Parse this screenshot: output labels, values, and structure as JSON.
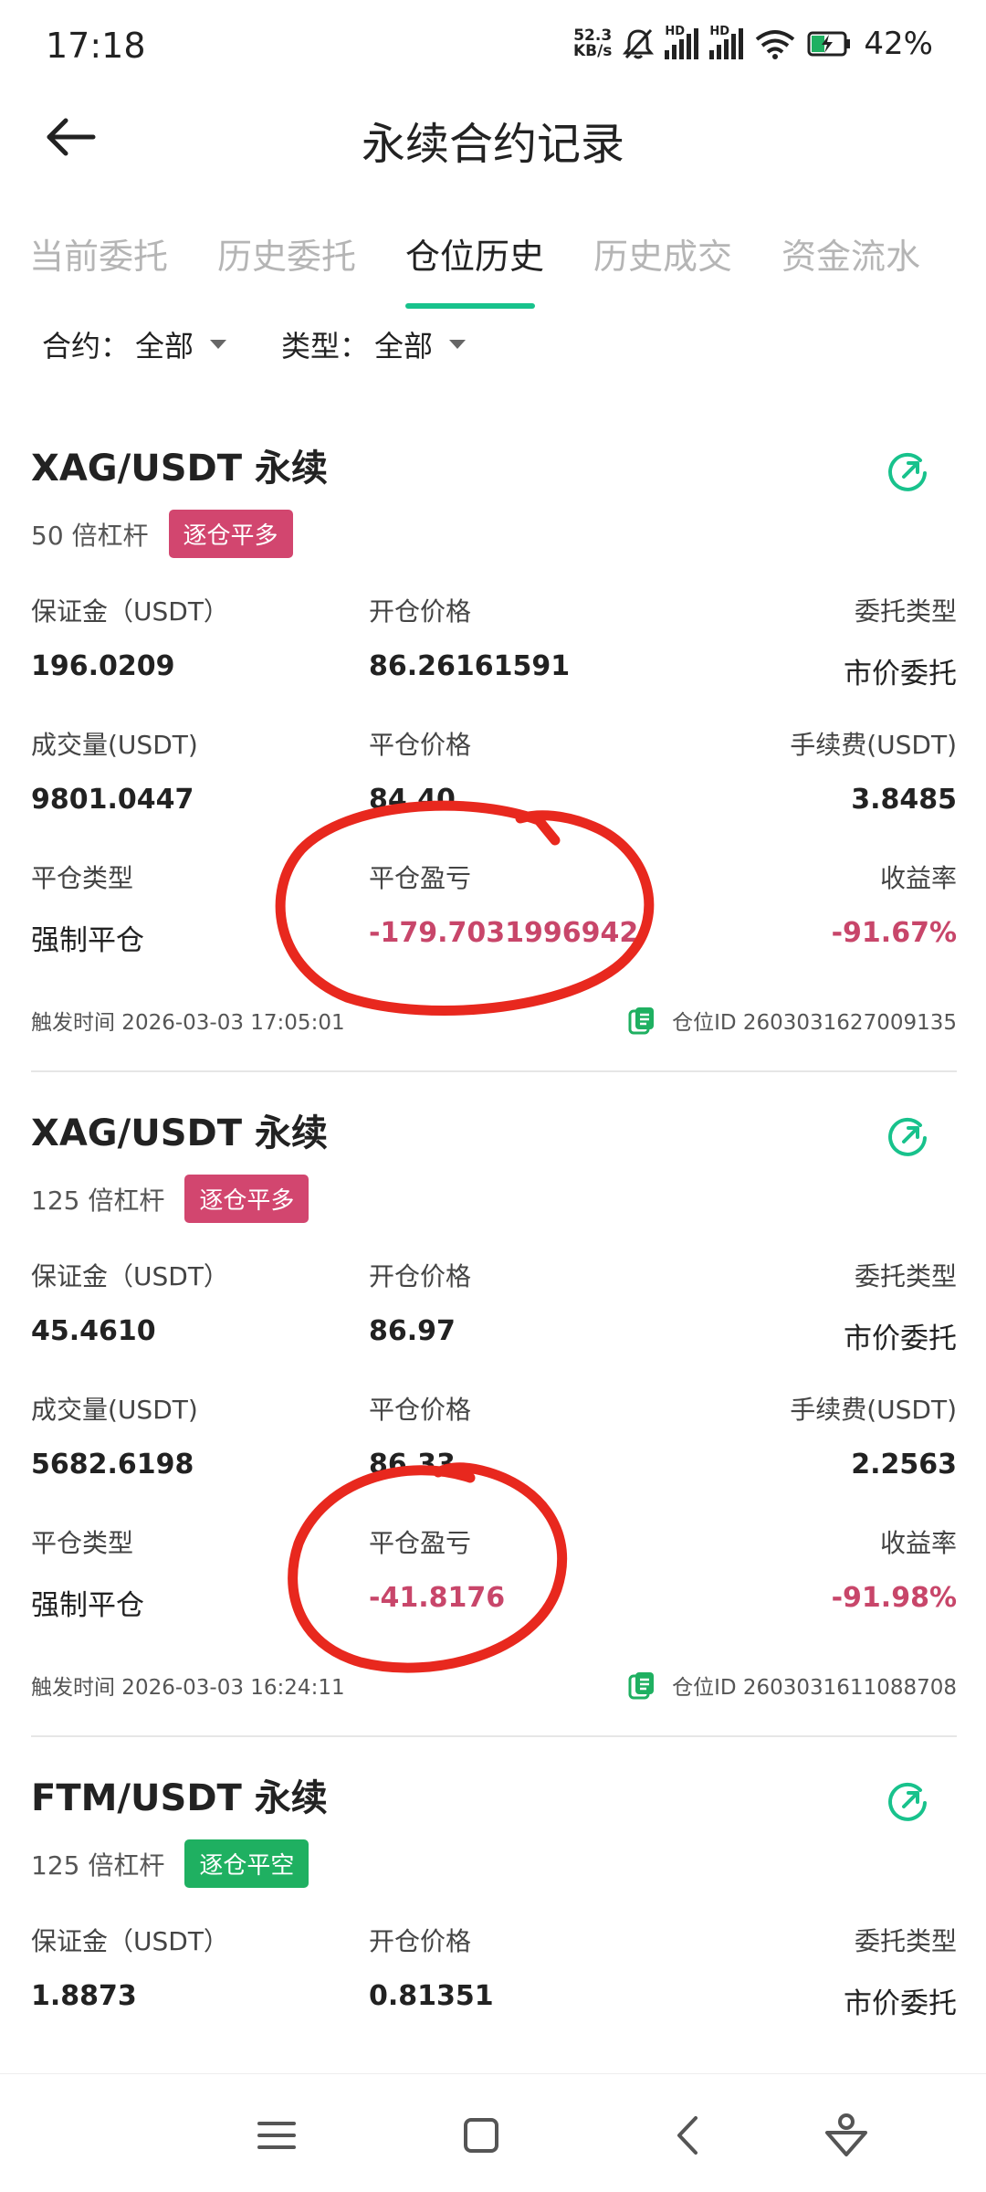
{
  "status_bar": {
    "time": "17:18",
    "net_speed_value": "52.3",
    "net_speed_unit": "KB/s",
    "battery_percent": "42%",
    "icons": [
      "mute-bell-icon",
      "hd-signal-icon",
      "hd-signal-icon",
      "wifi-icon",
      "battery-charging-icon"
    ]
  },
  "header": {
    "title": "永续合约记录"
  },
  "tabs": [
    {
      "label": "当前委托"
    },
    {
      "label": "历史委托"
    },
    {
      "label": "仓位历史",
      "active": true
    },
    {
      "label": "历史成交"
    },
    {
      "label": "资金流水"
    }
  ],
  "filters": {
    "contract": {
      "label": "合约：",
      "value": "全部"
    },
    "type": {
      "label": "类型：",
      "value": "全部"
    }
  },
  "labels": {
    "margin": "保证金（USDT）",
    "open_price": "开仓价格",
    "order_type": "委托类型",
    "volume": "成交量(USDT)",
    "close_price": "平仓价格",
    "fee": "手续费(USDT)",
    "close_type": "平仓类型",
    "close_pnl": "平仓盈亏",
    "yield": "收益率"
  },
  "positions": [
    {
      "symbol": "XAG/USDT 永续",
      "leverage": "50 倍杠杆",
      "badge": "逐仓平多",
      "margin": "196.0209",
      "open_price": "86.26161591",
      "order_type": "市价委托",
      "volume": "9801.0447",
      "close_price": "84.40",
      "fee": "3.8485",
      "close_type": "强制平仓",
      "close_pnl": "-179.7031996942",
      "yield": "-91.67%",
      "trigger_time": "触发时间 2026-03-03 17:05:01",
      "position_id": "仓位ID 2603031627009135"
    },
    {
      "symbol": "XAG/USDT 永续",
      "leverage": "125 倍杠杆",
      "badge": "逐仓平多",
      "margin": "45.4610",
      "open_price": "86.97",
      "order_type": "市价委托",
      "volume": "5682.6198",
      "close_price": "86.33",
      "fee": "2.2563",
      "close_type": "强制平仓",
      "close_pnl": "-41.8176",
      "yield": "-91.98%",
      "trigger_time": "触发时间 2026-03-03 16:24:11",
      "position_id": "仓位ID 2603031611088708"
    },
    {
      "symbol": "FTM/USDT 永续",
      "leverage": "125 倍杠杆",
      "badge": "逐仓平空",
      "margin": "1.8873",
      "open_price": "0.81351",
      "order_type": "市价委托"
    }
  ],
  "colors": {
    "accent": "#18c28c",
    "loss_red": "#c8466a",
    "badge_long": "#d2466f",
    "badge_short": "#1fb061",
    "annotation": "#e8281e"
  },
  "navbar": {
    "icons": [
      "menu-icon",
      "home-square-icon",
      "back-chevron-icon",
      "assistant-icon"
    ]
  }
}
